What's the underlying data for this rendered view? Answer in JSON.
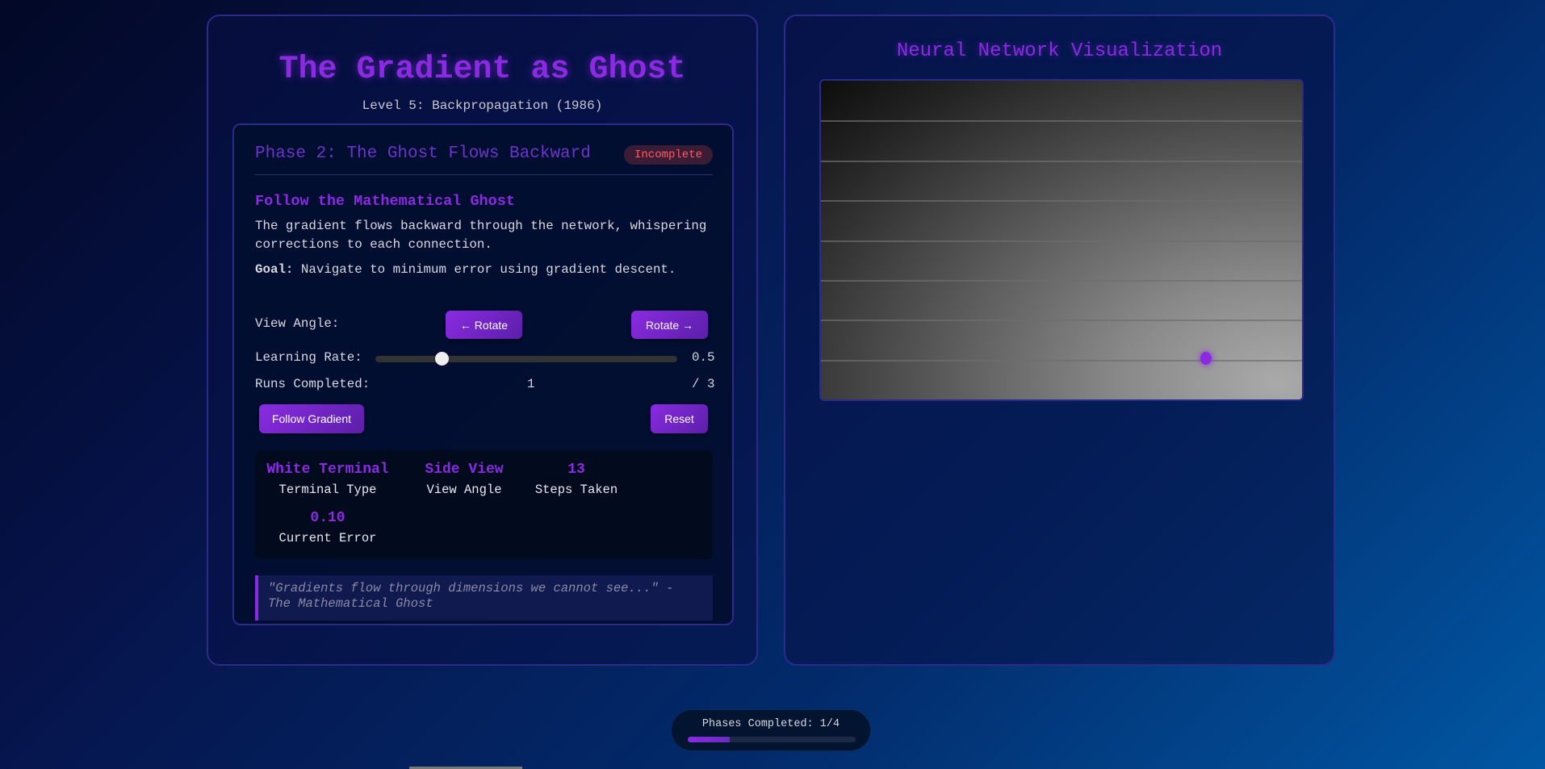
{
  "header": {
    "title": "The Gradient as Ghost",
    "subtitle": "Level 5: Backpropagation (1986)"
  },
  "phase": {
    "title": "Phase 2: The Ghost Flows Backward",
    "status": "Incomplete",
    "heading": "Follow the Mathematical Ghost",
    "description": "The gradient flows backward through the network, whispering corrections to each connection.",
    "goal_label": "Goal:",
    "goal_text": " Navigate to minimum error using gradient descent."
  },
  "controls": {
    "view_angle_label": "View Angle:",
    "rotate_left": "← Rotate",
    "rotate_right": "Rotate →",
    "learning_rate_label": "Learning Rate:",
    "learning_rate_value": "0.5",
    "learning_rate_fraction": 0.22,
    "runs_label": "Runs Completed:",
    "runs_value": "1",
    "runs_total": "/ 3",
    "follow_button": "Follow Gradient",
    "reset_button": "Reset"
  },
  "stats": [
    {
      "value": "White Terminal",
      "label": "Terminal Type"
    },
    {
      "value": "Side View",
      "label": "View Angle"
    },
    {
      "value": "13",
      "label": "Steps Taken"
    },
    {
      "value": "0.10",
      "label": "Current Error"
    }
  ],
  "quote": "\"Gradients flow through dimensions we cannot see...\" - The Mathematical Ghost",
  "visualization": {
    "title": "Neural Network Visualization",
    "grid_rows": 8
  },
  "progress": {
    "label": "Phases Completed: 1/4",
    "completed": 1,
    "total": 4
  },
  "colors": {
    "accent": "#8a2be2",
    "incomplete": "#ff5a6a"
  }
}
